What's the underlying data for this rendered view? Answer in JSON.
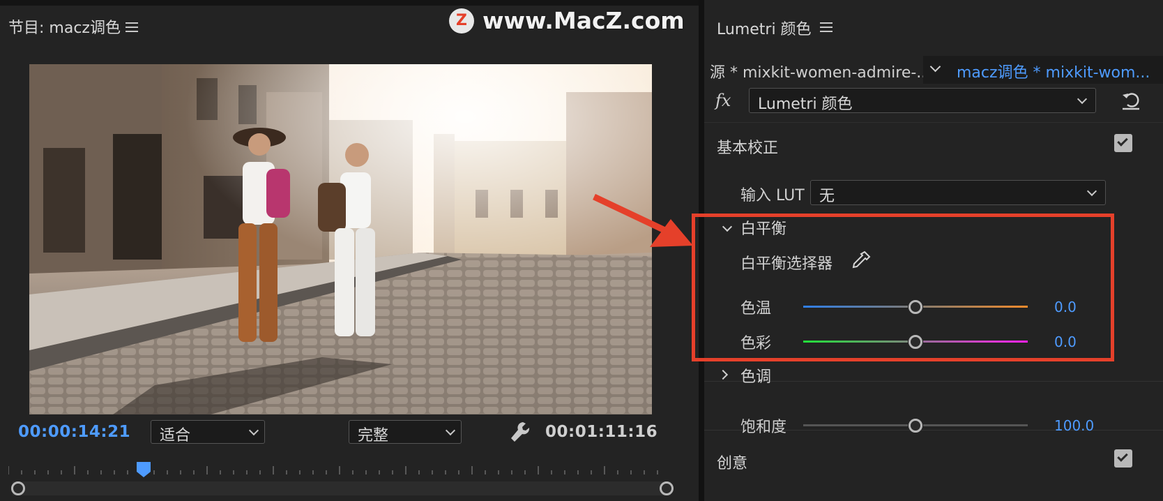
{
  "colors": {
    "accent_blue": "#4e9bff",
    "highlight_red": "#e5402a",
    "panel_bg": "#232323"
  },
  "watermark": {
    "text": "www.MacZ.com",
    "logo_letter": "Z"
  },
  "program_monitor": {
    "title": "节目: macz调色",
    "current_timecode": "00:00:14:21",
    "zoom_select": "适合",
    "quality_select": "完整",
    "duration_timecode": "00:01:11:16",
    "icons": [
      "panel-menu-icon",
      "wrench-icon",
      "playhead-marker-icon"
    ]
  },
  "lumetri": {
    "title": "Lumetri 颜色",
    "source_tab": "源 * mixkit-women-admire-...",
    "active_clip_tab": "macz调色 * mixkit-wom...",
    "fx_label": "fx",
    "effect_select": "Lumetri 颜色",
    "basic_correction": {
      "heading": "基本校正",
      "enabled": true,
      "input_lut_label": "输入 LUT",
      "input_lut_value": "无",
      "white_balance": {
        "heading": "白平衡",
        "expanded": true,
        "picker_label": "白平衡选择器",
        "temperature": {
          "label": "色温",
          "value": "0.0",
          "level": 0.5
        },
        "tint": {
          "label": "色彩",
          "value": "0.0",
          "level": 0.5
        }
      },
      "tone": {
        "heading": "色调",
        "expanded": false
      },
      "saturation": {
        "label": "饱和度",
        "value": "100.0",
        "level": 0.5
      }
    },
    "creative": {
      "heading": "创意",
      "enabled": true
    }
  }
}
